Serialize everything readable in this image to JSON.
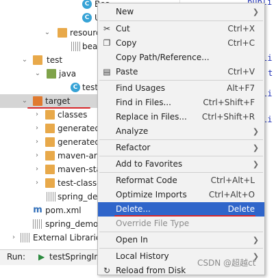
{
  "tree": {
    "rows": [
      {
        "label": "Bea",
        "icon": "class-icon"
      },
      {
        "label": "U",
        "icon": "class-icon"
      },
      {
        "label": "resourc",
        "icon": "resources-folder-icon"
      },
      {
        "label": "bea",
        "icon": "file-icon"
      },
      {
        "label": "test",
        "icon": "folder-icon"
      },
      {
        "label": "java",
        "icon": "test-source-folder-icon"
      },
      {
        "label": "testS",
        "icon": "class-icon"
      },
      {
        "label": "target",
        "icon": "folder-icon",
        "selected": true
      },
      {
        "label": "classes",
        "icon": "folder-icon"
      },
      {
        "label": "generated",
        "icon": "folder-icon"
      },
      {
        "label": "generated",
        "icon": "folder-icon"
      },
      {
        "label": "maven-arc",
        "icon": "folder-icon"
      },
      {
        "label": "maven-sta",
        "icon": "folder-icon"
      },
      {
        "label": "test-classe",
        "icon": "folder-icon"
      },
      {
        "label": "spring_dem",
        "icon": "archive-icon"
      },
      {
        "label": "pom.xml",
        "icon": "maven-icon"
      },
      {
        "label": "spring_demo",
        "icon": "module-file-icon"
      },
      {
        "label": "External Librarie",
        "icon": "library-icon"
      }
    ]
  },
  "run_bar": {
    "label": "Run:",
    "config": "testSpringIn"
  },
  "editor": {
    "lines": [
      "publi",
      "li",
      "t",
      "li",
      "li"
    ]
  },
  "context_menu": {
    "items": [
      {
        "label": "New",
        "mnemonic_before": "",
        "mnemonic": "",
        "mnemonic_after": "",
        "shortcut": "",
        "submenu": true
      },
      {
        "label": "Cut",
        "shortcut": "Ctrl+X",
        "icon": "scissors-icon"
      },
      {
        "label": "Copy",
        "shortcut": "Ctrl+C",
        "icon": "copy-icon"
      },
      {
        "label": "Copy Path/Reference...",
        "shortcut": ""
      },
      {
        "label": "Paste",
        "shortcut": "Ctrl+V",
        "icon": "paste-icon"
      },
      {
        "label": "Find Usages",
        "shortcut": "Alt+F7"
      },
      {
        "label": "Find in Files...",
        "shortcut": "Ctrl+Shift+F"
      },
      {
        "label": "Replace in Files...",
        "shortcut": "Ctrl+Shift+R"
      },
      {
        "label": "Analyze",
        "shortcut": "",
        "submenu": true
      },
      {
        "label": "Refactor",
        "shortcut": "",
        "submenu": true
      },
      {
        "label": "Add to Favorites",
        "shortcut": "",
        "submenu": true
      },
      {
        "label": "Reformat Code",
        "shortcut": "Ctrl+Alt+L"
      },
      {
        "label": "Optimize Imports",
        "shortcut": "Ctrl+Alt+O"
      },
      {
        "label": "Delete...",
        "shortcut": "Delete",
        "highlighted": true
      },
      {
        "label": "Override File Type",
        "shortcut": "",
        "disabled": true
      },
      {
        "label": "Open In",
        "shortcut": "",
        "submenu": true
      },
      {
        "label": "Local History",
        "shortcut": "",
        "submenu": true
      },
      {
        "label": "Reload from Disk",
        "shortcut": "",
        "icon": "reload-icon"
      }
    ]
  },
  "watermark": "CSDN @超越ct",
  "colors": {
    "highlight": "#2f65ca",
    "annotation": "#d8282b",
    "menu_bg": "#f2f2f2"
  }
}
